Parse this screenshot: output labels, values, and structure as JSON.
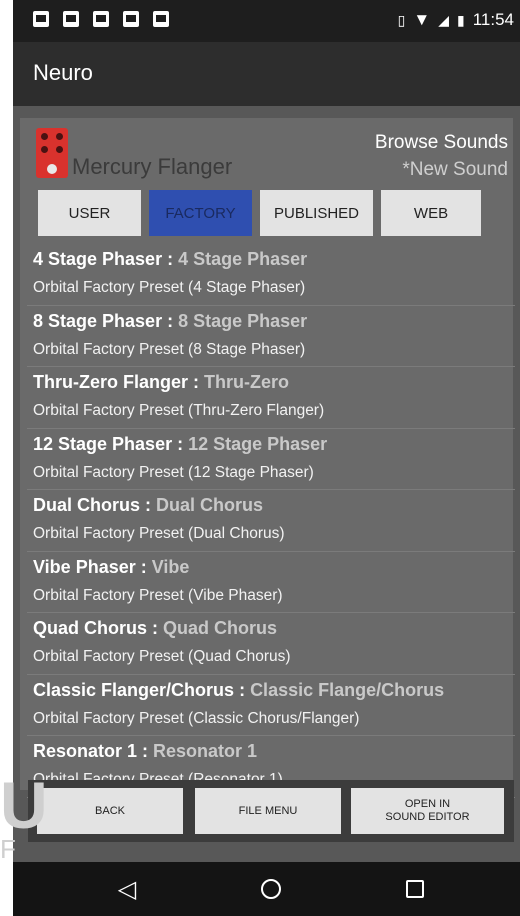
{
  "statusbar": {
    "icons": [
      "notification-icon",
      "image-icon",
      "mail-icon",
      "video-icon",
      "clipboard-icon"
    ],
    "vibrate": "▯",
    "time": "11:54"
  },
  "app": {
    "title": "Neuro"
  },
  "header": {
    "device_name": "Mercury Flanger",
    "browse_label": "Browse Sounds",
    "sound_label": "*New Sound"
  },
  "tabs": [
    {
      "label": "USER",
      "active": false
    },
    {
      "label": "FACTORY",
      "active": true
    },
    {
      "label": "PUBLISHED",
      "active": false
    },
    {
      "label": "WEB",
      "active": false
    }
  ],
  "presets": [
    {
      "name": "4 Stage Phaser",
      "sep": " : ",
      "short": "4 Stage Phaser",
      "desc": "Orbital Factory Preset (4 Stage Phaser)"
    },
    {
      "name": "8 Stage Phaser",
      "sep": " : ",
      "short": "8 Stage Phaser",
      "desc": "Orbital Factory Preset (8 Stage Phaser)"
    },
    {
      "name": "Thru-Zero Flanger",
      "sep": " : ",
      "short": "Thru-Zero",
      "desc": "Orbital Factory Preset (Thru-Zero Flanger)"
    },
    {
      "name": "12 Stage Phaser",
      "sep": " : ",
      "short": "12 Stage Phaser",
      "desc": "Orbital Factory Preset (12 Stage Phaser)"
    },
    {
      "name": "Dual Chorus",
      "sep": " : ",
      "short": "Dual Chorus",
      "desc": "Orbital Factory Preset (Dual Chorus)"
    },
    {
      "name": "Vibe Phaser",
      "sep": " : ",
      "short": "Vibe",
      "desc": "Orbital Factory Preset (Vibe Phaser)"
    },
    {
      "name": "Quad Chorus",
      "sep": " : ",
      "short": "Quad Chorus",
      "desc": "Orbital Factory Preset (Quad Chorus)"
    },
    {
      "name": "Classic Flanger/Chorus",
      "sep": " : ",
      "short": "Classic Flange/Chorus",
      "desc": "Orbital Factory Preset (Classic Chorus/Flanger)"
    },
    {
      "name": "Resonator 1",
      "sep": " : ",
      "short": "Resonator 1",
      "desc": "Orbital Factory Preset (Resonator 1)"
    }
  ],
  "bottom": {
    "back": "BACK",
    "file_menu": "FILE MENU",
    "open_line1": "OPEN IN",
    "open_line2": "SOUND EDITOR"
  },
  "watermark": {
    "letter": "U",
    "sub": "F"
  },
  "colors": {
    "accent": "#2f4fb0",
    "appbar": "#2d2d2d",
    "panel": "#6a6a6a"
  }
}
